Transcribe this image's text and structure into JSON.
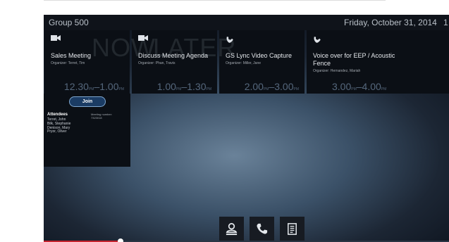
{
  "header": {
    "room_name": "Group 500",
    "date": "Friday, October 31, 2014",
    "time": "1"
  },
  "timeline": {
    "now_label": "NOW",
    "later_label": "LATER"
  },
  "meetings": [
    {
      "type_icon": "video-camera-icon",
      "title": "Sales Meeting",
      "organizer": "Organizer: Terret, Tim",
      "start": "12.30",
      "start_ampm": "PM",
      "end": "1.00",
      "end_ampm": "PM"
    },
    {
      "type_icon": "video-camera-icon",
      "title": "Discuss Meeting Agenda",
      "organizer": "Organizer: Phan, Travis",
      "start": "1.00",
      "start_ampm": "PM",
      "end": "1.30",
      "end_ampm": "PM"
    },
    {
      "type_icon": "phone-icon",
      "title": "GS Lync Video Capture",
      "organizer": "Organizer: Miller, Jane",
      "start": "2.00",
      "start_ampm": "PM",
      "end": "3.00",
      "end_ampm": "PM"
    },
    {
      "type_icon": "phone-icon",
      "title": "Voice over for EEP / Acoustic Fence",
      "organizer": "Organizer: Hernandez, Mariah",
      "start": "3.00",
      "start_ampm": "PM",
      "end": "4.00",
      "end_ampm": "PM"
    }
  ],
  "selected_meeting": {
    "join_label": "Join",
    "attendees_heading": "Attendees",
    "attendees": [
      "Terret, John",
      "Bilk, Stephanie",
      "Denison, Mary",
      "Pryor, Oliver"
    ],
    "meeting_number_label": "Meeting number:",
    "meeting_number": "7323018"
  },
  "dock": [
    {
      "icon": "contacts-icon"
    },
    {
      "icon": "phone-icon"
    },
    {
      "icon": "directory-icon"
    }
  ],
  "progress": {
    "fraction": 0.19
  },
  "colors": {
    "accent": "#c62530",
    "card_bg": "#0b0f15",
    "join_border": "#7fa7cf"
  }
}
